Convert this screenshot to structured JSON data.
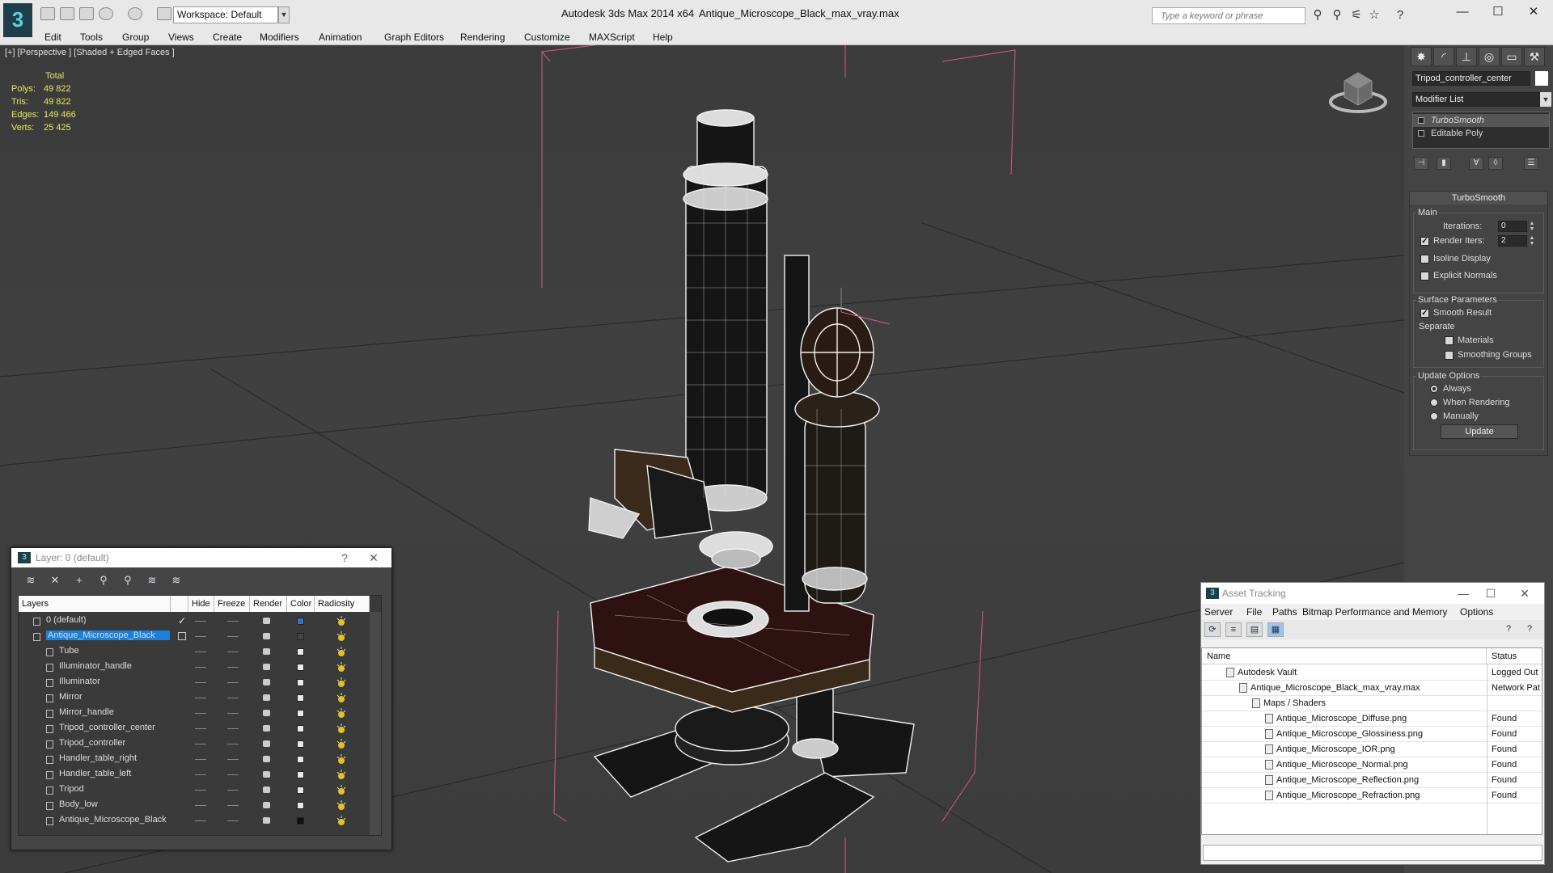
{
  "app": {
    "logo_glyph": "3",
    "workspace": "Workspace: Default",
    "title": "Autodesk 3ds Max  2014 x64",
    "file": "Antique_Microscope_Black_max_vray.max",
    "search_placeholder": "Type a keyword or phrase"
  },
  "menu": [
    "Edit",
    "Tools",
    "Group",
    "Views",
    "Create",
    "Modifiers",
    "Animation",
    "Graph Editors",
    "Rendering",
    "Customize",
    "MAXScript",
    "Help"
  ],
  "viewport": {
    "label": "[+] [Perspective ] [Shaded + Edged Faces ]",
    "stats_header": "Total",
    "stats": [
      {
        "label": "Polys:",
        "value": "49 822"
      },
      {
        "label": "Tris:",
        "value": "49 822"
      },
      {
        "label": "Edges:",
        "value": "149 466"
      },
      {
        "label": "Verts:",
        "value": "25 425"
      }
    ],
    "colors": {
      "wire": "#f2f2f2",
      "fill": "#171717",
      "stage": "#2e1111",
      "bbox": "#d85a7a"
    }
  },
  "command_panel": {
    "object_name": "Tripod_controller_center",
    "modifier_list": "Modifier List",
    "stack": [
      "TurboSmooth",
      "Editable Poly"
    ],
    "rollout": {
      "title": "TurboSmooth",
      "main_group": "Main",
      "iterations_label": "Iterations:",
      "iterations_value": "0",
      "render_iters_label": "Render Iters:",
      "render_iters_value": "2",
      "isoline_label": "Isoline Display",
      "explicit_label": "Explicit Normals",
      "surface_group": "Surface Parameters",
      "smooth_label": "Smooth Result",
      "separate_label": "Separate",
      "materials_label": "Materials",
      "smoothing_label": "Smoothing Groups",
      "update_group": "Update Options",
      "always_label": "Always",
      "when_rendering_label": "When Rendering",
      "manually_label": "Manually",
      "update_button": "Update"
    }
  },
  "layer_window": {
    "title": "Layer: 0 (default)",
    "help": "?",
    "close": "✕",
    "columns": [
      "Layers",
      "Hide",
      "Freeze",
      "Render",
      "Color",
      "Radiosity"
    ],
    "rows": [
      {
        "name": "0 (default)",
        "level": 0,
        "color": "#3d6ec8",
        "active": true
      },
      {
        "name": "Antique_Microscope_Black",
        "level": 0,
        "color": "#444444",
        "selected": true
      },
      {
        "name": "Tube",
        "level": 1,
        "color": "#e8e8e8"
      },
      {
        "name": "Illuminator_handle",
        "level": 1,
        "color": "#e8e8e8"
      },
      {
        "name": "Illuminator",
        "level": 1,
        "color": "#e8e8e8"
      },
      {
        "name": "Mirror",
        "level": 1,
        "color": "#e8e8e8"
      },
      {
        "name": "Mirror_handle",
        "level": 1,
        "color": "#e8e8e8"
      },
      {
        "name": "Tripod_controller_center",
        "level": 1,
        "color": "#e8e8e8"
      },
      {
        "name": "Tripod_controller",
        "level": 1,
        "color": "#e8e8e8"
      },
      {
        "name": "Handler_table_right",
        "level": 1,
        "color": "#e8e8e8"
      },
      {
        "name": "Handler_table_left",
        "level": 1,
        "color": "#e8e8e8"
      },
      {
        "name": "Tripod",
        "level": 1,
        "color": "#e8e8e8"
      },
      {
        "name": "Body_low",
        "level": 1,
        "color": "#e8e8e8"
      },
      {
        "name": "Antique_Microscope_Black",
        "level": 1,
        "color": "#111111"
      }
    ]
  },
  "asset_window": {
    "title": "Asset Tracking",
    "menu": [
      "Server",
      "File",
      "Paths",
      "Bitmap Performance and Memory",
      "Options"
    ],
    "columns": [
      "Name",
      "Status"
    ],
    "rows": [
      {
        "name": "Autodesk Vault",
        "level": 1,
        "status": "Logged Out"
      },
      {
        "name": "Antique_Microscope_Black_max_vray.max",
        "level": 2,
        "status": "Network Pat"
      },
      {
        "name": "Maps / Shaders",
        "level": 3,
        "status": ""
      },
      {
        "name": "Antique_Microscope_Diffuse.png",
        "level": 4,
        "status": "Found"
      },
      {
        "name": "Antique_Microscope_Glossiness.png",
        "level": 4,
        "status": "Found"
      },
      {
        "name": "Antique_Microscope_IOR.png",
        "level": 4,
        "status": "Found"
      },
      {
        "name": "Antique_Microscope_Normal.png",
        "level": 4,
        "status": "Found"
      },
      {
        "name": "Antique_Microscope_Reflection.png",
        "level": 4,
        "status": "Found"
      },
      {
        "name": "Antique_Microscope_Refraction.png",
        "level": 4,
        "status": "Found"
      }
    ]
  },
  "icons": {
    "search": "search-icon",
    "star": "favorites-icon",
    "help": "help-icon",
    "minimize": "—",
    "maximize": "☐",
    "close": "✕"
  }
}
